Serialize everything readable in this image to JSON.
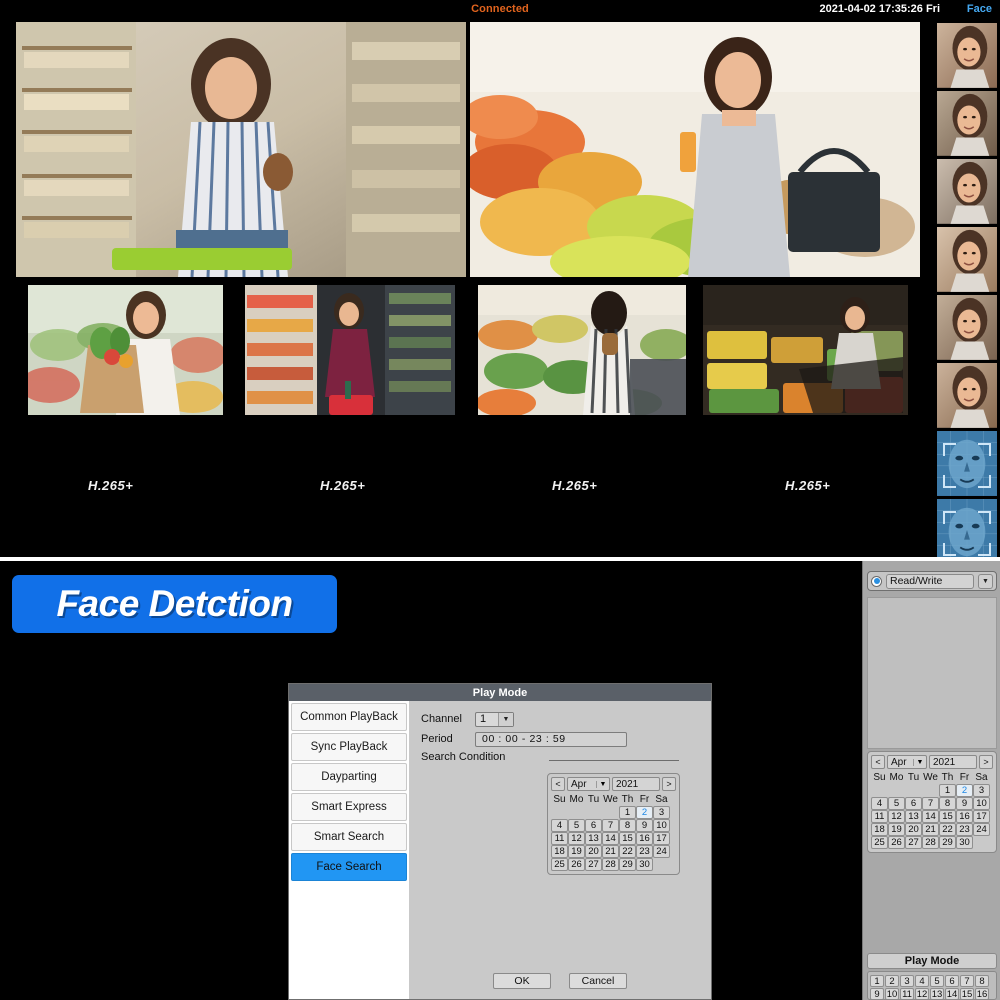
{
  "topbar": {
    "connected_label": "Connected",
    "timestamp": "2021-04-02 17:35:26 Fri",
    "face_tab_label": "Face",
    "connected_color": "#e2641e",
    "face_tab_color": "#45a8f0"
  },
  "live": {
    "codec_labels": [
      "H.265+",
      "H.265+",
      "H.265+",
      "H.265+"
    ],
    "main_tiles": [
      {
        "alt": "woman shopping in grocery aisle holding jar"
      },
      {
        "alt": "woman in grey top holding juice at produce counter"
      }
    ],
    "small_tiles": [
      {
        "alt": "woman carrying paper grocery bag with vegetables"
      },
      {
        "alt": "woman in red dress with shopping basket in aisle"
      },
      {
        "alt": "woman picking broccoli with shopping cart"
      },
      {
        "alt": "woman with cart at fruit display"
      }
    ],
    "face_thumbs": [
      {
        "alt": "smiling woman face crop 1",
        "type": "photo"
      },
      {
        "alt": "woman looking down face crop 2",
        "type": "photo"
      },
      {
        "alt": "woman in grey top face crop 3",
        "type": "photo"
      },
      {
        "alt": "smiling woman face crop 4",
        "type": "photo"
      },
      {
        "alt": "woman face crop 5",
        "type": "photo"
      },
      {
        "alt": "woman face crop 6",
        "type": "photo"
      },
      {
        "alt": "face recognition scan overlay 1",
        "type": "scan"
      },
      {
        "alt": "face recognition scan overlay 2",
        "type": "scan"
      }
    ]
  },
  "banner": {
    "text": "Face Detction",
    "background": "#1170e8",
    "text_color": "#ffffff"
  },
  "dialog": {
    "title": "Play Mode",
    "side_buttons": [
      {
        "label": "Common PlayBack",
        "active": false
      },
      {
        "label": "Sync PlayBack",
        "active": false
      },
      {
        "label": "Dayparting",
        "active": false
      },
      {
        "label": "Smart Express",
        "active": false
      },
      {
        "label": "Smart Search",
        "active": false
      },
      {
        "label": "Face Search",
        "active": true
      }
    ],
    "channel_label": "Channel",
    "channel_value": "1",
    "period_label": "Period",
    "period_value": "00 : 00   -   23 : 59",
    "search_condition_label": "Search Condition",
    "calendar": {
      "prev": "<",
      "next": ">",
      "month": "Apr",
      "year": "2021",
      "dow": [
        "Su",
        "Mo",
        "Tu",
        "We",
        "Th",
        "Fr",
        "Sa"
      ],
      "lead_blanks": 4,
      "days": [
        1,
        2,
        3,
        4,
        5,
        6,
        7,
        8,
        9,
        10,
        11,
        12,
        13,
        14,
        15,
        16,
        17,
        18,
        19,
        20,
        21,
        22,
        23,
        24,
        25,
        26,
        27,
        28,
        29,
        30
      ],
      "selected_day": 2,
      "selected_color": "#1e88e5"
    },
    "ok_label": "OK",
    "cancel_label": "Cancel"
  },
  "right_panel": {
    "read_write_label": "Read/Write",
    "calendar": {
      "prev": "<",
      "next": ">",
      "month": "Apr",
      "year": "2021",
      "dow": [
        "Su",
        "Mo",
        "Tu",
        "We",
        "Th",
        "Fr",
        "Sa"
      ],
      "lead_blanks": 4,
      "days": [
        1,
        2,
        3,
        4,
        5,
        6,
        7,
        8,
        9,
        10,
        11,
        12,
        13,
        14,
        15,
        16,
        17,
        18,
        19,
        20,
        21,
        22,
        23,
        24,
        25,
        26,
        27,
        28,
        29,
        30
      ],
      "selected_day": 2,
      "selected_color": "#1e88e5"
    },
    "play_mode_label": "Play Mode",
    "channels": [
      1,
      2,
      3,
      4,
      5,
      6,
      7,
      8,
      9,
      10,
      11,
      12,
      13,
      14,
      15,
      16
    ]
  }
}
